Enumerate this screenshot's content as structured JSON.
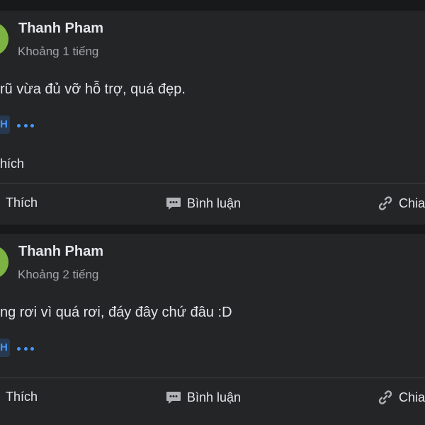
{
  "posts": [
    {
      "author": "Thanh Pham",
      "time": "Khoảng 1 tiếng",
      "content": "rũ vừa đủ vỡ hỗ trợ, quá đẹp.",
      "reaction_chip": "H",
      "like_summary": "hích",
      "actions": {
        "like": "Thích",
        "comment": "Bình luận",
        "share": "Chia"
      }
    },
    {
      "author": "Thanh Pham",
      "time": "Khoảng 2 tiếng",
      "content": "ng rơi vì quá rơi, đáy đây chứ đâu :D",
      "reaction_chip": "H",
      "actions": {
        "like": "Thích",
        "comment": "Bình luận",
        "share": "Chia"
      }
    }
  ],
  "colors": {
    "background": "#18191a",
    "card": "#242526",
    "text_primary": "#e4e6eb",
    "text_secondary": "#a0a3a8",
    "accent": "#4599ff",
    "avatar": "#7cb342"
  },
  "icons": {
    "comment": "comment-icon",
    "share": "link-icon",
    "more": "more-dots-icon"
  }
}
